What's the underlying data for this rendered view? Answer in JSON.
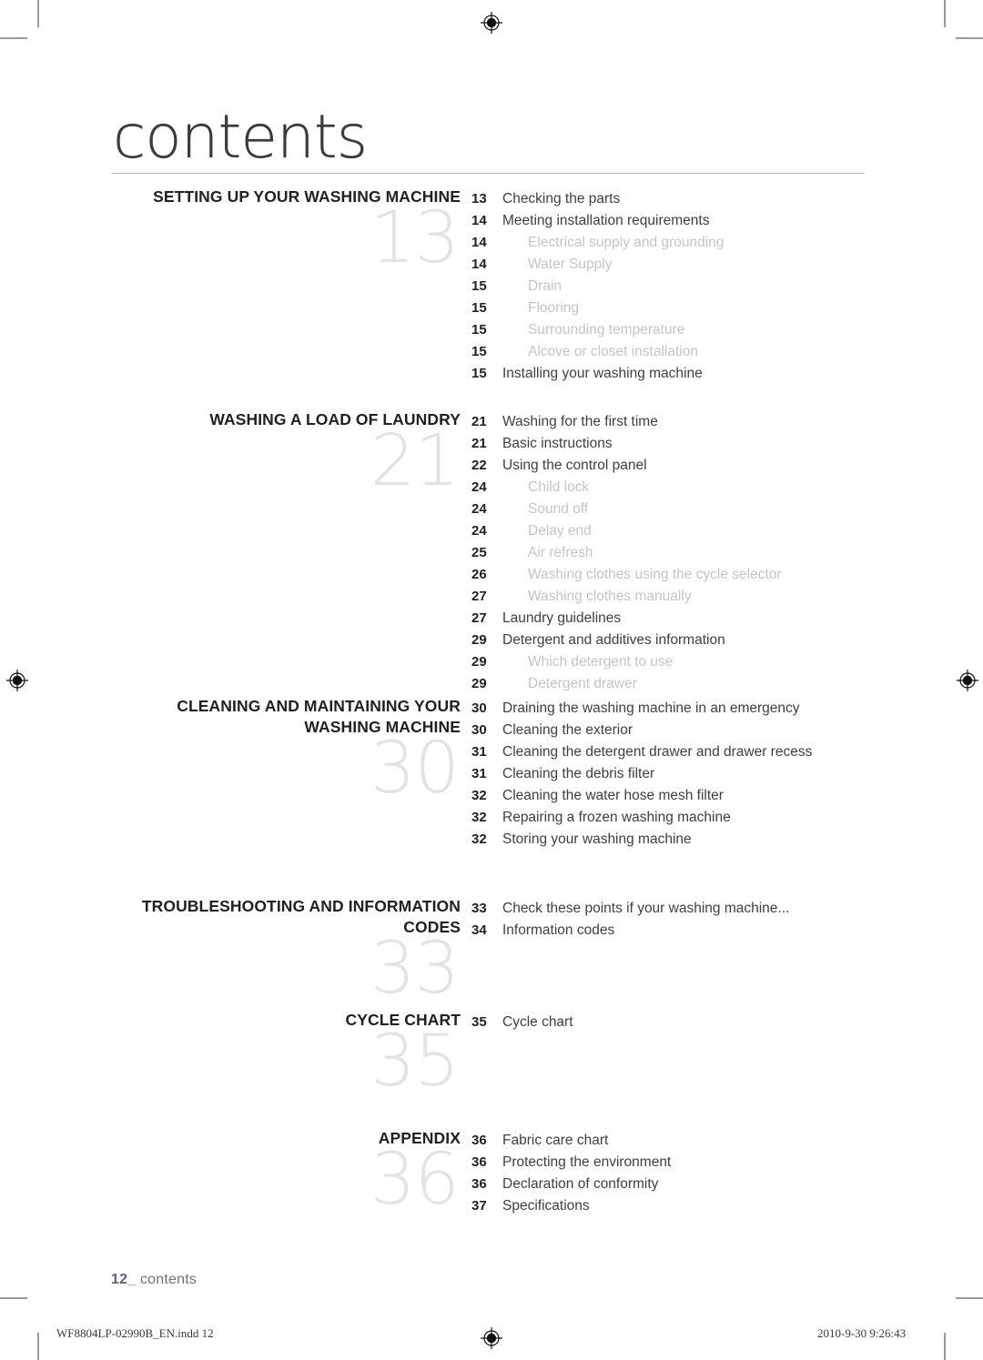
{
  "document": {
    "title": "contents",
    "folio_number": "12",
    "folio_separator": "_",
    "folio_label": "contents",
    "production_file": "WF8804LP-02990B_EN.indd   12",
    "production_timestamp": "2010-9-30   9:26:43",
    "colors": {
      "heading_text": "#231f20",
      "entry_text": "#403e40",
      "sub_entry_text": "#c6c4c6",
      "big_number": "#e3e3e4",
      "title_text": "#3b3b3d",
      "folio_text": "#6d7283",
      "rule": "#b9b9bb",
      "crop_mark": "#9a9a9c"
    },
    "marks": {
      "registration_top": "registration-target-icon",
      "registration_bottom": "registration-target-icon",
      "registration_left": "registration-target-icon",
      "registration_right": "registration-target-icon"
    }
  },
  "sections": [
    {
      "heading": "SETTING UP YOUR WASHING MACHINE",
      "big_number": "13",
      "entries": [
        {
          "page": "13",
          "label": "Checking the parts",
          "sub": false
        },
        {
          "page": "14",
          "label": "Meeting installation requirements",
          "sub": false
        },
        {
          "page": "14",
          "label": "Electrical supply and grounding",
          "sub": true
        },
        {
          "page": "14",
          "label": "Water Supply",
          "sub": true
        },
        {
          "page": "15",
          "label": "Drain",
          "sub": true
        },
        {
          "page": "15",
          "label": "Flooring",
          "sub": true
        },
        {
          "page": "15",
          "label": "Surrounding temperature",
          "sub": true
        },
        {
          "page": "15",
          "label": "Alcove or closet installation",
          "sub": true
        },
        {
          "page": "15",
          "label": "Installing your washing machine",
          "sub": false
        }
      ]
    },
    {
      "heading": "WASHING A LOAD OF LAUNDRY",
      "big_number": "21",
      "entries": [
        {
          "page": "21",
          "label": "Washing for the first time",
          "sub": false
        },
        {
          "page": "21",
          "label": "Basic instructions",
          "sub": false
        },
        {
          "page": "22",
          "label": "Using the control panel",
          "sub": false
        },
        {
          "page": "24",
          "label": "Child lock",
          "sub": true
        },
        {
          "page": "24",
          "label": "Sound off",
          "sub": true
        },
        {
          "page": "24",
          "label": "Delay end",
          "sub": true
        },
        {
          "page": "25",
          "label": "Air refresh",
          "sub": true
        },
        {
          "page": "26",
          "label": "Washing clothes using the cycle selector",
          "sub": true
        },
        {
          "page": "27",
          "label": "Washing clothes manually",
          "sub": true
        },
        {
          "page": "27",
          "label": "Laundry guidelines",
          "sub": false
        },
        {
          "page": "29",
          "label": "Detergent and additives information",
          "sub": false
        },
        {
          "page": "29",
          "label": "Which detergent to use",
          "sub": true
        },
        {
          "page": "29",
          "label": "Detergent drawer",
          "sub": true
        }
      ]
    },
    {
      "heading": "CLEANING AND MAINTAINING YOUR WASHING MACHINE",
      "big_number": "30",
      "entries": [
        {
          "page": "30",
          "label": "Draining the washing machine in an emergency",
          "sub": false
        },
        {
          "page": "30",
          "label": "Cleaning the exterior",
          "sub": false
        },
        {
          "page": "31",
          "label": "Cleaning the detergent drawer and drawer recess",
          "sub": false
        },
        {
          "page": "31",
          "label": "Cleaning the debris filter",
          "sub": false
        },
        {
          "page": "32",
          "label": "Cleaning the water hose mesh filter",
          "sub": false
        },
        {
          "page": "32",
          "label": "Repairing a frozen washing machine",
          "sub": false
        },
        {
          "page": "32",
          "label": "Storing your washing machine",
          "sub": false
        }
      ]
    },
    {
      "heading": "TROUBLESHOOTING AND INFORMATION CODES",
      "big_number": "33",
      "entries": [
        {
          "page": "33",
          "label": "Check these points if your washing machine...",
          "sub": false
        },
        {
          "page": "34",
          "label": "Information codes",
          "sub": false
        }
      ]
    },
    {
      "heading": "CYCLE CHART",
      "big_number": "35",
      "entries": [
        {
          "page": "35",
          "label": "Cycle chart",
          "sub": false
        }
      ]
    },
    {
      "heading": "APPENDIX",
      "big_number": "36",
      "entries": [
        {
          "page": "36",
          "label": "Fabric care chart",
          "sub": false
        },
        {
          "page": "36",
          "label": "Protecting the environment",
          "sub": false
        },
        {
          "page": "36",
          "label": "Declaration of conformity",
          "sub": false
        },
        {
          "page": "37",
          "label": "Specifications",
          "sub": false
        }
      ]
    }
  ]
}
